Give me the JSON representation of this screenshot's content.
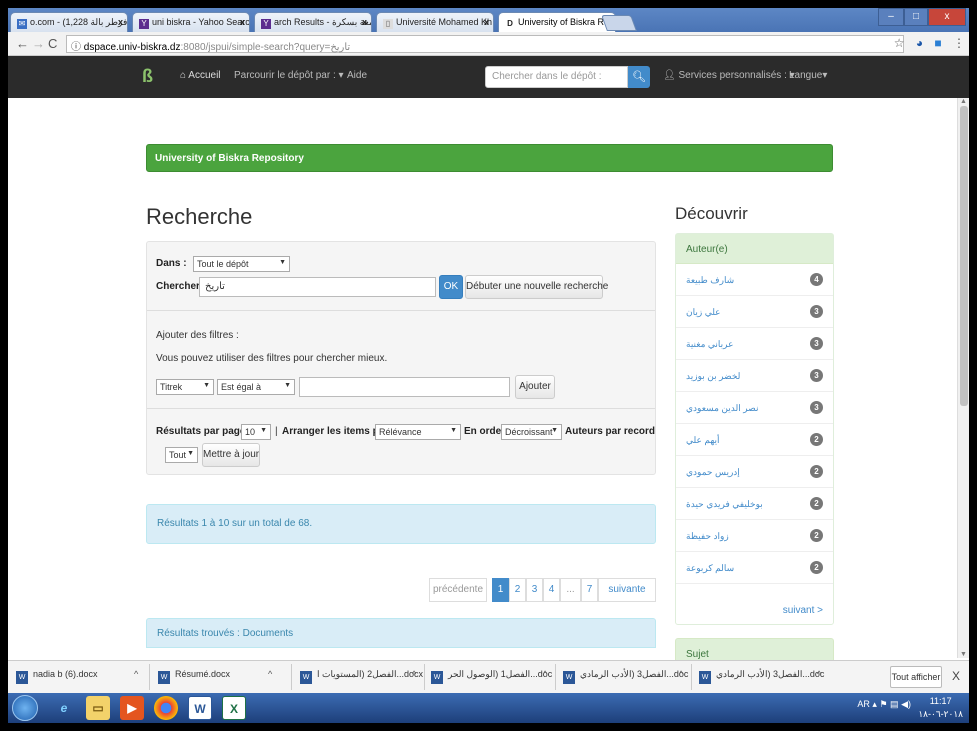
{
  "browser": {
    "tabs": [
      {
        "label": "o.com - (فرطر بالة 1,228) ",
        "icon": "mail-icon"
      },
      {
        "label": "uni biskra - Yahoo Search",
        "icon": "yahoo-icon"
      },
      {
        "label": "arch Results - جامعة بسكرة",
        "icon": "yahoo-icon"
      },
      {
        "label": "Université Mohamed Kh",
        "icon": "page-icon"
      },
      {
        "label": "University of Biskra Repo",
        "icon": "dspace-icon"
      }
    ],
    "url_host": "dspace.univ-biskra.dz",
    "url_path": ":8080/jspui/simple-search?query=تاريخ",
    "window_controls": [
      "–",
      "□",
      "x"
    ]
  },
  "navbar": {
    "home": "Accueil",
    "browse": "Parcourir le dépôt par :",
    "help": "Aide",
    "search_placeholder": "Chercher dans le dépôt :",
    "services": "Services personnalisés :",
    "language": "Langue"
  },
  "banner": "University of Biskra Repository",
  "search": {
    "heading": "Recherche",
    "scope_label": "Dans :",
    "scope_value": "Tout le dépôt",
    "query_label": "Chercher",
    "query_value": "تاريخ",
    "ok": "OK",
    "new_search": "Débuter une nouvelle recherche",
    "add_filters": "Ajouter des filtres :",
    "filters_help": "Vous pouvez utiliser des filtres pour chercher mieux.",
    "filter_field": "Titrek",
    "filter_op": "Est égal à",
    "add_button": "Ajouter",
    "rpp_label": "Résultats par page",
    "rpp_value": "10",
    "sep": "|",
    "sort_label": "Arranger les items par",
    "sort_value": "Rélévance",
    "order_label": "En order",
    "order_value": "Décroissant",
    "authors_label": "Auteurs par record",
    "authors_value": "Tout",
    "update_button": "Mettre à jour"
  },
  "results": {
    "summary": "Résultats 1 à 10 sur un total de 68.",
    "docs_heading": "Résultats trouvés : Documents"
  },
  "pagination": {
    "prev": "précédente",
    "pages": [
      "1",
      "2",
      "3",
      "4",
      "...",
      "7"
    ],
    "next": "suivante",
    "current": "1"
  },
  "discover": {
    "heading": "Découvrir",
    "facet_title": "Auteur(e)",
    "items": [
      {
        "name": "شارف طبيعة",
        "count": "4"
      },
      {
        "name": "علي زيان",
        "count": "3"
      },
      {
        "name": "عرباني مغنية",
        "count": "3"
      },
      {
        "name": "لخضر بن بوزيد",
        "count": "3"
      },
      {
        "name": "نصر الدين مسعودي",
        "count": "3"
      },
      {
        "name": "أيهم علي",
        "count": "2"
      },
      {
        "name": "إدريس حمودي",
        "count": "2"
      },
      {
        "name": "بوخليفي فريدي حيدة",
        "count": "2"
      },
      {
        "name": "زواد حفيظة",
        "count": "2"
      },
      {
        "name": "سالم كربوعة",
        "count": "2"
      }
    ],
    "more": "suivant >",
    "facet2_title": "Sujet"
  },
  "downloads": {
    "items": [
      "nadia b (6).docx",
      "Résumé.docx",
      "الفصل2 (المستويات ا...docx",
      "الفصل1 (الوصول الحر...doc",
      "الفصل3 (الأدب الرمادي...doc",
      "الفصل3 (الأدب الرمادي...doc"
    ],
    "show_all": "Tout afficher",
    "close": "X"
  },
  "taskbar": {
    "lang": "AR",
    "time": "11:17",
    "date": "٢٠١٨-٠٦-١٨"
  }
}
